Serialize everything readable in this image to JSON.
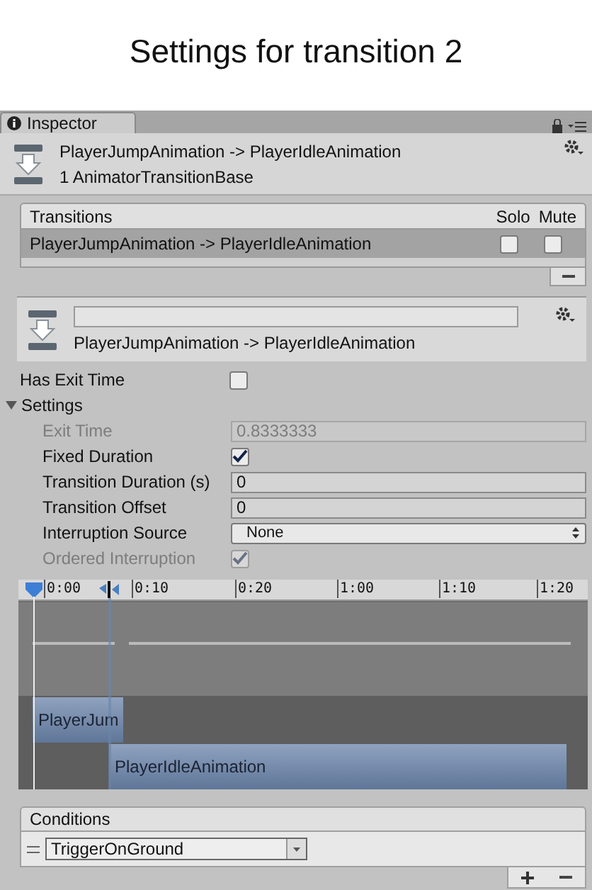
{
  "page_title": "Settings for transition 2",
  "tab": {
    "label": "Inspector"
  },
  "header": {
    "title": "PlayerJumpAnimation -> PlayerIdleAnimation",
    "subtitle": "1 AnimatorTransitionBase"
  },
  "transitions": {
    "columns": [
      "Transitions",
      "Solo",
      "Mute"
    ],
    "rows": [
      {
        "name": "PlayerJumpAnimation -> PlayerIdleAnimation",
        "selected": true,
        "solo": false,
        "mute": false
      }
    ]
  },
  "transition_header": {
    "subtitle": "PlayerJumpAnimation -> PlayerIdleAnimation"
  },
  "has_exit_time": {
    "label": "Has Exit Time",
    "checked": false
  },
  "settings": {
    "label": "Settings",
    "expanded": true,
    "rows": [
      {
        "kind": "field",
        "label": "Exit Time",
        "value": "0.8333333",
        "disabled": true
      },
      {
        "kind": "checkbox",
        "label": "Fixed Duration",
        "checked": true,
        "disabled": false
      },
      {
        "kind": "field",
        "label": "Transition Duration (s)",
        "value": "0",
        "disabled": false
      },
      {
        "kind": "field",
        "label": "Transition Offset",
        "value": "0",
        "disabled": false
      },
      {
        "kind": "select",
        "label": "Interruption Source",
        "value": "None",
        "disabled": false
      },
      {
        "kind": "checkbox",
        "label": "Ordered Interruption",
        "checked": true,
        "disabled": true
      }
    ]
  },
  "timeline": {
    "ticks": [
      "0:00",
      "0:10",
      "0:20",
      "1:00",
      "1:10",
      "1:20"
    ],
    "clips": [
      {
        "name": "PlayerJum"
      },
      {
        "name": "PlayerIdleAnimation"
      }
    ]
  },
  "conditions": {
    "title": "Conditions",
    "items": [
      {
        "parameter": "TriggerOnGround"
      }
    ]
  }
}
